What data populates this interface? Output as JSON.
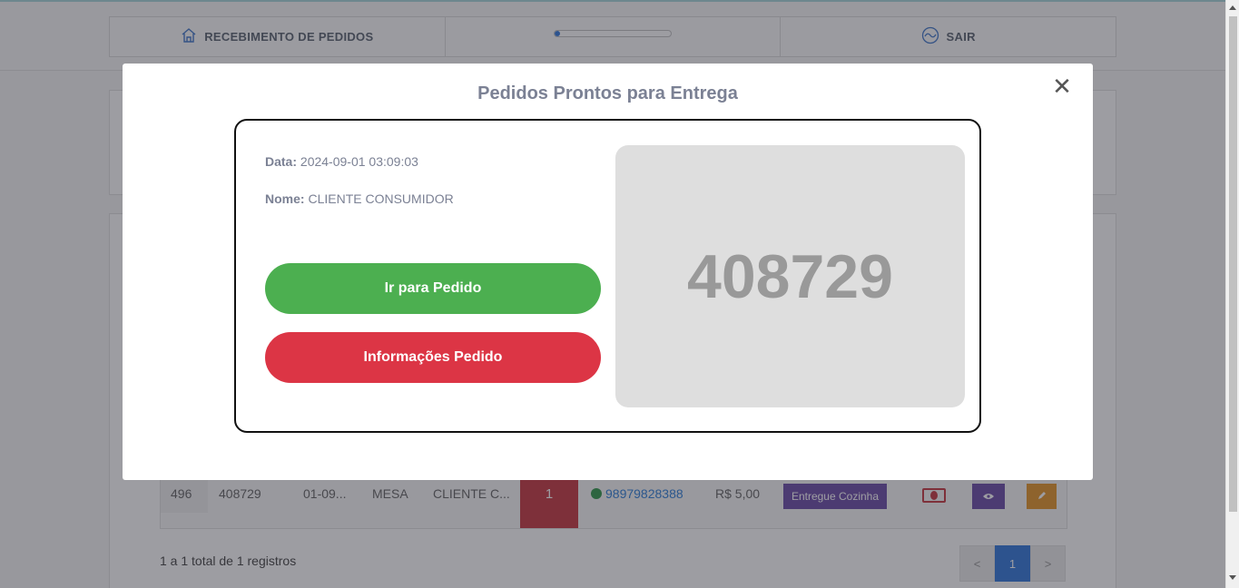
{
  "nav": {
    "receive_label": "RECEBIMENTO DE PEDIDOS",
    "progress_percent": 5,
    "exit_label": "SAIR"
  },
  "table": {
    "row": {
      "id": "496",
      "order": "408729",
      "date": "01-09...",
      "type": "MESA",
      "client": "CLIENTE C...",
      "qty": "1",
      "phone": "98979828388",
      "price": "R$ 5,00",
      "status": "Entregue Cozinha"
    }
  },
  "footer": {
    "summary": "1 a 1 total de 1 registros",
    "pager": {
      "prev": "<",
      "current": "1",
      "next": ">"
    }
  },
  "modal": {
    "title": "Pedidos Prontos para Entrega",
    "close_glyph": "✕",
    "date_label": "Data:",
    "date_value": "2024-09-01 03:09:03",
    "name_label": "Nome:",
    "name_value": "CLIENTE CONSUMIDOR",
    "go_button": "Ir para Pedido",
    "info_button": "Informações Pedido",
    "order_number": "408729"
  },
  "colors": {
    "green": "#4caf50",
    "red": "#dc3545",
    "purple": "#5d3a9f",
    "orange": "#e08a14",
    "blue": "#1e6bd6"
  },
  "icons": {
    "home": "home-icon",
    "exit": "exit-icon",
    "whatsapp": "whatsapp-icon",
    "money": "money-icon",
    "eye": "eye-icon",
    "edit": "pencil-icon",
    "close": "close-icon"
  }
}
